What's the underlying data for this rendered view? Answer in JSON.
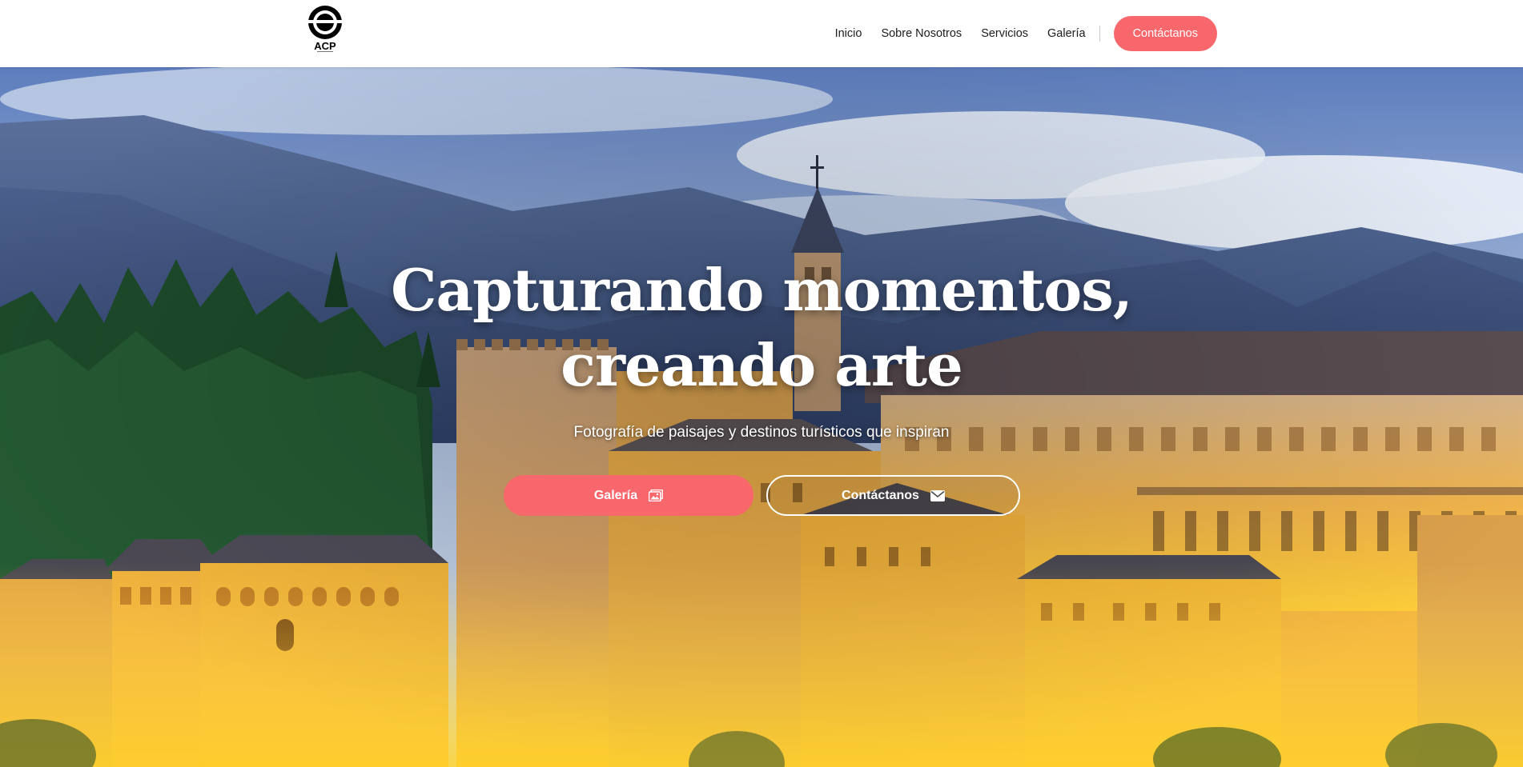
{
  "brand": {
    "logo_text": "ACP"
  },
  "nav": {
    "items": [
      {
        "label": "Inicio"
      },
      {
        "label": "Sobre Nosotros"
      },
      {
        "label": "Servicios"
      },
      {
        "label": "Galería"
      }
    ],
    "cta_label": "Contáctanos"
  },
  "hero": {
    "title_line1": "Capturando momentos,",
    "title_line2": "creando arte",
    "subtitle": "Fotografía de paisajes y destinos turísticos que inspiran",
    "primary_button": {
      "label": "Galería",
      "icon": "image-icon"
    },
    "secondary_button": {
      "label": "Contáctanos",
      "icon": "envelope-icon"
    }
  },
  "colors": {
    "accent": "#f8676c",
    "text_dark": "#1c1c1c",
    "white": "#ffffff"
  }
}
